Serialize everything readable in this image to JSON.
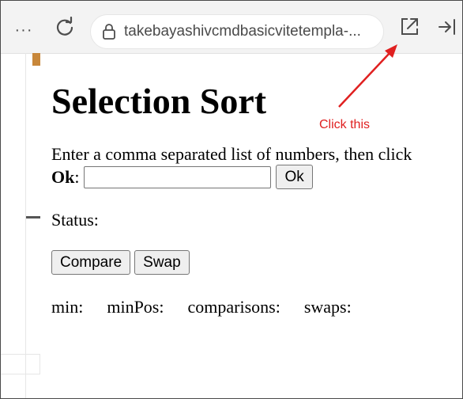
{
  "browser": {
    "url": "takebayashivcmdbasicvitetempla-...",
    "icons": [
      "more-icon",
      "reload-icon",
      "lock-icon",
      "open-external-icon",
      "collapse-sidebar-icon"
    ]
  },
  "page": {
    "title": "Selection Sort",
    "instruction_text": "Enter a comma separated list of numbers, then click",
    "instruction_bold": "Ok",
    "instruction_colon": ":",
    "input_value": "",
    "ok_button": "Ok",
    "status_label": "Status:",
    "compare_button": "Compare",
    "swap_button": "Swap",
    "stats": {
      "min": "min:",
      "minPos": "minPos:",
      "comparisons": "comparisons:",
      "swaps": "swaps:"
    }
  },
  "annotation": {
    "text": "Click this",
    "color": "#e02020"
  },
  "colors": {
    "toolbar_bg": "#f3f3f3",
    "accent_orange": "#c8873a"
  }
}
